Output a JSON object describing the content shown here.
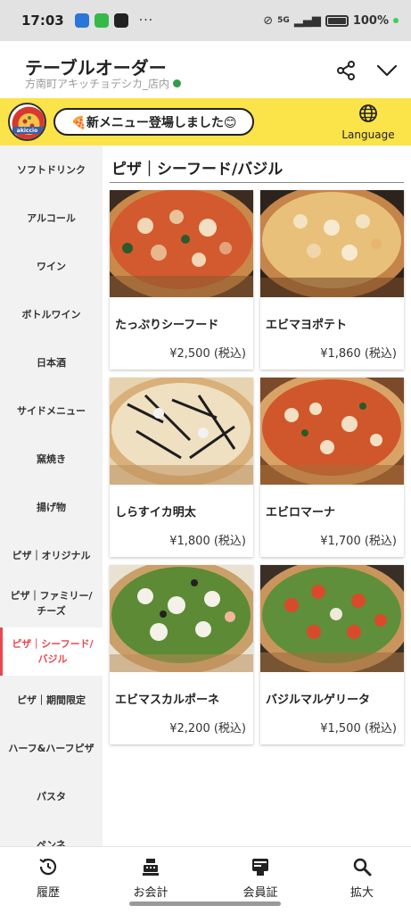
{
  "status_bar": {
    "time": "17:03",
    "network": "5G",
    "battery": "100%"
  },
  "header": {
    "title": "テーブルオーダー",
    "subtitle": "方南町アキッチョデシカ_店内"
  },
  "notice": {
    "logo_text": "akiccio",
    "message": "🍕新メニュー登場しました😊",
    "language_label": "Language"
  },
  "sidebar": {
    "items": [
      {
        "label": "ソフトドリンク"
      },
      {
        "label": "アルコール"
      },
      {
        "label": "ワイン"
      },
      {
        "label": "ボトルワイン"
      },
      {
        "label": "日本酒"
      },
      {
        "label": "サイドメニュー"
      },
      {
        "label": "窯焼き"
      },
      {
        "label": "揚げ物"
      },
      {
        "label": "ピザ｜オリジナル"
      },
      {
        "label": "ピザ｜ファミリー/チーズ"
      },
      {
        "label": "ピザ｜シーフード/バジル",
        "active": true
      },
      {
        "label": "ピザ｜期間限定"
      },
      {
        "label": "ハーフ&ハーフピザ"
      },
      {
        "label": "パスタ"
      },
      {
        "label": "ペンネ"
      }
    ]
  },
  "main": {
    "section_title": "ピザ｜シーフード/バジル",
    "items": [
      {
        "name": "たっぷりシーフード",
        "price": "¥2,500 (税込)",
        "image": "seafood-pizza"
      },
      {
        "name": "エビマヨポテト",
        "price": "¥1,860 (税込)",
        "image": "shrimp-mayo-pizza"
      },
      {
        "name": "しらすイカ明太",
        "price": "¥1,800 (税込)",
        "image": "shirasu-pizza"
      },
      {
        "name": "エビロマーナ",
        "price": "¥1,700 (税込)",
        "image": "ebi-romana-pizza"
      },
      {
        "name": "エビマスカルポーネ",
        "price": "¥2,200 (税込)",
        "image": "basil-shrimp-pizza"
      },
      {
        "name": "バジルマルゲリータ",
        "price": "¥1,500 (税込)",
        "image": "basil-margherita-pizza"
      }
    ]
  },
  "bottom_nav": [
    {
      "label": "履歴",
      "icon": "history-icon"
    },
    {
      "label": "お会計",
      "icon": "register-icon"
    },
    {
      "label": "会員証",
      "icon": "member-card-icon"
    },
    {
      "label": "拡大",
      "icon": "zoom-icon"
    }
  ],
  "colors": {
    "accent": "#e8484e",
    "notice_bg": "#fbe34a",
    "sidebar_bg": "#f2f2f2"
  }
}
